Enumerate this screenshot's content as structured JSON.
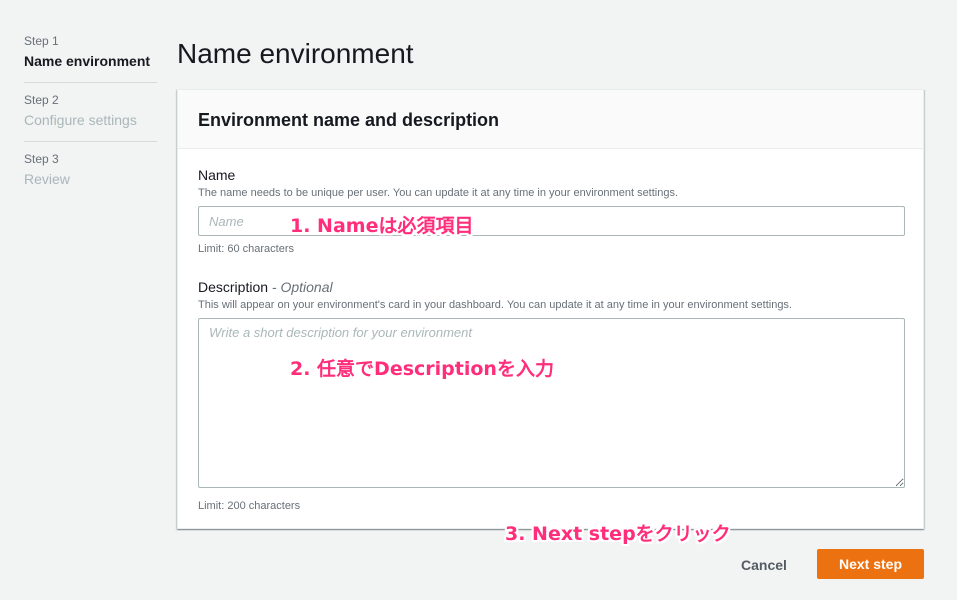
{
  "sidebar": {
    "steps": [
      {
        "number": "Step 1",
        "title": "Name environment"
      },
      {
        "number": "Step 2",
        "title": "Configure settings"
      },
      {
        "number": "Step 3",
        "title": "Review"
      }
    ]
  },
  "page": {
    "title": "Name environment"
  },
  "panel": {
    "header": "Environment name and description",
    "name_field": {
      "label": "Name",
      "description": "The name needs to be unique per user. You can update it at any time in your environment settings.",
      "placeholder": "Name",
      "value": "",
      "limit": "Limit: 60 characters"
    },
    "description_field": {
      "label": "Description",
      "optional": "- Optional",
      "description": "This will appear on your environment's card in your dashboard. You can update it at any time in your environment settings.",
      "placeholder": "Write a short description for your environment",
      "value": "",
      "limit": "Limit: 200 characters"
    }
  },
  "annotations": {
    "a1": "1. Nameは必須項目",
    "a2": "2. 任意でDescriptionを入力",
    "a3": "3. Next stepをクリック"
  },
  "footer": {
    "cancel_label": "Cancel",
    "next_label": "Next step"
  },
  "colors": {
    "accent": "#ec7211",
    "annotation": "#ff2d7a",
    "background": "#f2f3f3"
  }
}
